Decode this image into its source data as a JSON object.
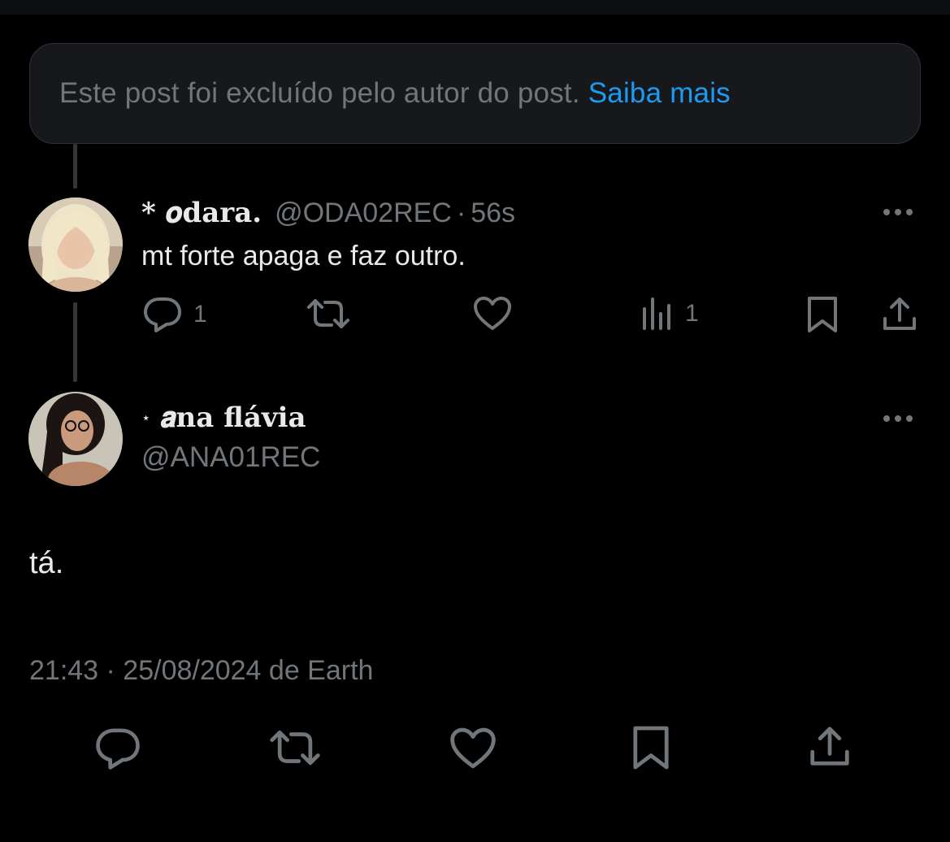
{
  "notice": {
    "text": "Este post foi excluído pelo autor do post.",
    "link": "Saiba mais"
  },
  "reply": {
    "display_name": "* 𝒐dara.",
    "handle": "@ODA02REC",
    "separator": "·",
    "time": "56s",
    "text": "mt forte apaga e faz outro.",
    "reply_count": "1",
    "views_count": "1"
  },
  "main_post": {
    "star": "⋆",
    "display_name": "𝒂na flávia",
    "handle": "@ANA01REC",
    "text": "tá.",
    "timestamp": "21:43 · 25/08/2024 de Earth"
  },
  "icons": {
    "reply": "speech-bubble-icon",
    "repost": "repost-arrows-icon",
    "like": "heart-icon",
    "views": "bar-chart-icon",
    "bookmark": "bookmark-icon",
    "share": "share-upload-icon",
    "more": "more-dots-icon"
  },
  "colors": {
    "background": "#000000",
    "text": "#e7e9ea",
    "muted": "#71767b",
    "link": "#1d9bf0",
    "notice_bg": "#16181c"
  }
}
